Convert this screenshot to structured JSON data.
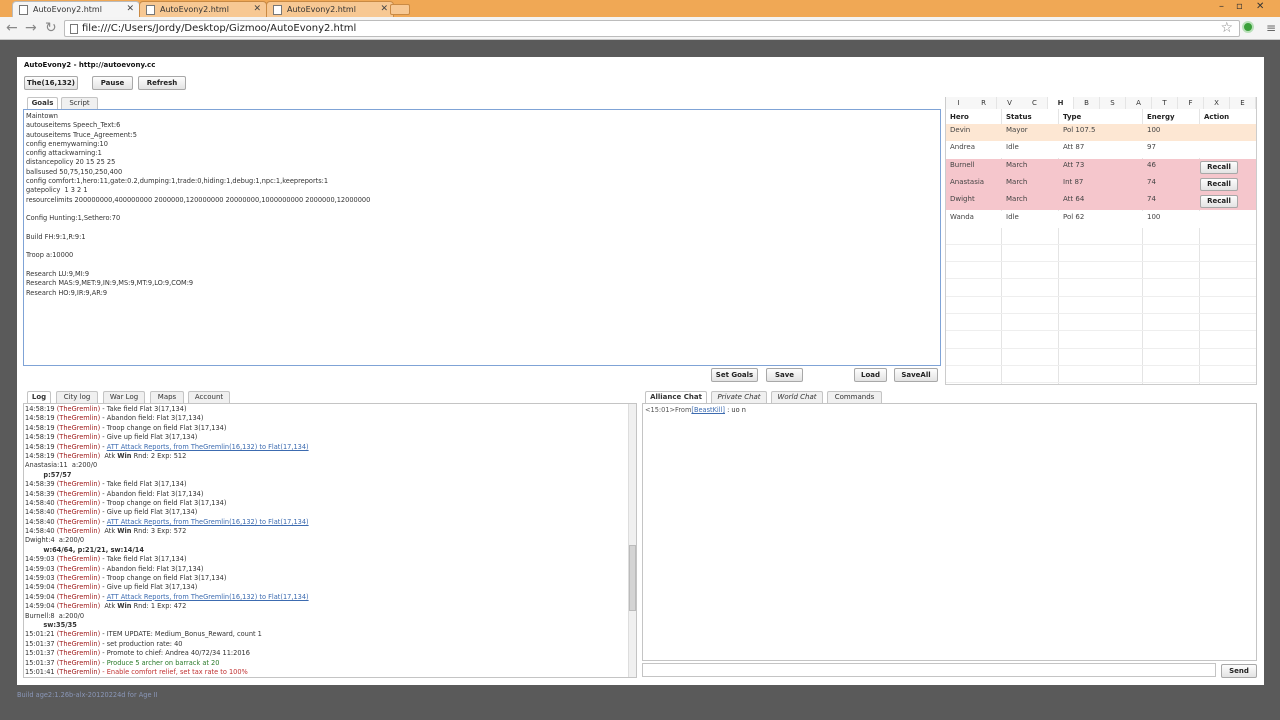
{
  "browser": {
    "tabs": [
      {
        "title": "AutoEvony2.html"
      },
      {
        "title": "AutoEvony2.html"
      },
      {
        "title": "AutoEvony2.html"
      }
    ],
    "url": "file:///C:/Users/Jordy/Desktop/Gizmoo/AutoEvony2.html"
  },
  "app": {
    "title": "AutoEvony2 - http://autoevony.cc",
    "toolbar": {
      "city": "The(16,132)",
      "pause": "Pause",
      "refresh": "Refresh"
    },
    "goal_tabs": [
      "Goals",
      "Script"
    ],
    "goals_text": "Maintown\nautouseitems Speech_Text:6\nautouseitems Truce_Agreement:5\nconfig enemywarning:10\nconfig attackwarning:1\ndistancepolicy 20 15 25 25\nballsused 50,75,150,250,400\nconfig comfort:1,hero:11,gate:0.2,dumping:1,trade:0,hiding:1,debug:1,npc:1,keepreports:1\ngatepolicy  1 3 2 1\nresourcelimits 200000000,400000000 2000000,120000000 20000000,1000000000 2000000,12000000\n\nConfig Hunting:1,Sethero:70\n\nBuild FH:9:1,R:9:1\n\nTroop a:10000\n\nResearch LU:9,MI:9\nResearch MAS:9,MET:9,IN:9,MS:9,MT:9,LO:9,COM:9\nResearch HO:9,IR:9,AR:9",
    "goal_buttons": {
      "set_goals": "Set Goals",
      "save": "Save",
      "load": "Load",
      "save_all": "SaveAll"
    },
    "hero_letters": [
      "I",
      "R",
      "V",
      "C",
      "H",
      "B",
      "S",
      "A",
      "T",
      "F",
      "X",
      "E"
    ],
    "hero_columns": [
      "Hero",
      "Status",
      "Type",
      "Energy",
      "Action"
    ],
    "heroes": [
      {
        "name": "Devin",
        "status": "Mayor",
        "type": "Pol 107.5",
        "energy": "100",
        "action": ""
      },
      {
        "name": "Andrea",
        "status": "Idle",
        "type": "Att 87",
        "energy": "97",
        "action": ""
      },
      {
        "name": "Burnell",
        "status": "March",
        "type": "Att 73",
        "energy": "46",
        "action": "Recall"
      },
      {
        "name": "Anastasia",
        "status": "March",
        "type": "Int 87",
        "energy": "74",
        "action": "Recall"
      },
      {
        "name": "Dwight",
        "status": "March",
        "type": "Att 64",
        "energy": "74",
        "action": "Recall"
      },
      {
        "name": "Wanda",
        "status": "Idle",
        "type": "Pol 62",
        "energy": "100",
        "action": ""
      }
    ],
    "log_tabs": [
      "Log",
      "City log",
      "War Log",
      "Maps",
      "Account"
    ],
    "log": [
      {
        "t": "14:58:19",
        "w": "(TheGremlin)",
        "m": " - Take field Flat 3(17,134)",
        "c": ""
      },
      {
        "t": "14:58:19",
        "w": "(TheGremlin)",
        "m": " - Abandon field: Flat 3(17,134)",
        "c": ""
      },
      {
        "t": "14:58:19",
        "w": "(TheGremlin)",
        "m": " - Troop change on field Flat 3(17,134)",
        "c": ""
      },
      {
        "t": "14:58:19",
        "w": "(TheGremlin)",
        "m": " - Give up field Flat 3(17,134)",
        "c": ""
      },
      {
        "t": "14:58:19",
        "w": "(TheGremlin)",
        "m": "ATT Attack Reports, from TheGremlin(16,132) to Flat(17,134)",
        "c": "lnk"
      },
      {
        "t": "14:58:19",
        "w": "(TheGremlin)",
        "m": "  Atk Win Rnd: 2 Exp: 512",
        "c": "atk"
      },
      {
        "raw": "Anastasia:11  a:200/0"
      },
      {
        "raw": "        p:57/57",
        "bold": true
      },
      {
        "t": "14:58:39",
        "w": "(TheGremlin)",
        "m": " - Take field Flat 3(17,134)",
        "c": ""
      },
      {
        "t": "14:58:39",
        "w": "(TheGremlin)",
        "m": " - Abandon field: Flat 3(17,134)",
        "c": ""
      },
      {
        "t": "14:58:40",
        "w": "(TheGremlin)",
        "m": " - Troop change on field Flat 3(17,134)",
        "c": ""
      },
      {
        "t": "14:58:40",
        "w": "(TheGremlin)",
        "m": " - Give up field Flat 3(17,134)",
        "c": ""
      },
      {
        "t": "14:58:40",
        "w": "(TheGremlin)",
        "m": "ATT Attack Reports, from TheGremlin(16,132) to Flat(17,134)",
        "c": "lnk"
      },
      {
        "t": "14:58:40",
        "w": "(TheGremlin)",
        "m": "  Atk Win Rnd: 3 Exp: 572",
        "c": "atk"
      },
      {
        "raw": "Dwight:4  a:200/0"
      },
      {
        "raw": "        w:64/64, p:21/21, sw:14/14",
        "bold": true
      },
      {
        "t": "14:59:03",
        "w": "(TheGremlin)",
        "m": " - Take field Flat 3(17,134)",
        "c": ""
      },
      {
        "t": "14:59:03",
        "w": "(TheGremlin)",
        "m": " - Abandon field: Flat 3(17,134)",
        "c": ""
      },
      {
        "t": "14:59:03",
        "w": "(TheGremlin)",
        "m": " - Troop change on field Flat 3(17,134)",
        "c": ""
      },
      {
        "t": "14:59:04",
        "w": "(TheGremlin)",
        "m": " - Give up field Flat 3(17,134)",
        "c": ""
      },
      {
        "t": "14:59:04",
        "w": "(TheGremlin)",
        "m": "ATT Attack Reports, from TheGremlin(16,132) to Flat(17,134)",
        "c": "lnk"
      },
      {
        "t": "14:59:04",
        "w": "(TheGremlin)",
        "m": "  Atk Win Rnd: 1 Exp: 472",
        "c": "atk"
      },
      {
        "raw": "Burnell:8  a:200/0"
      },
      {
        "raw": "        sw:35/35",
        "bold": true
      },
      {
        "t": "15:01:21",
        "w": "(TheGremlin)",
        "m": " - ITEM UPDATE: Medium_Bonus_Reward, count 1",
        "c": ""
      },
      {
        "t": "15:01:37",
        "w": "(TheGremlin)",
        "m": " - set production rate: 40",
        "c": ""
      },
      {
        "t": "15:01:37",
        "w": "(TheGremlin)",
        "m": " - Promote to chief: Andrea 40/72/34 11:2016",
        "c": ""
      },
      {
        "t": "15:01:37",
        "w": "(TheGremlin)",
        "m": " - Produce 5 archer on barrack at 20",
        "c": "grn"
      },
      {
        "t": "15:01:41",
        "w": "(TheGremlin)",
        "m": " - Enable comfort relief, set tax rate to 100%",
        "c": "red"
      }
    ],
    "chat_tabs": [
      "Alliance Chat",
      "Private Chat",
      "World Chat",
      "Commands"
    ],
    "chat": {
      "time": "<15:01>From",
      "user": "[BeastKill]",
      "msg": " : uo n"
    },
    "send": "Send",
    "status": "Build age2:1.26b-alx-20120224d for Age II"
  },
  "colors": {
    "accent": "#7fa3d6",
    "march_row": "#f5c6cc",
    "mayor_row": "#fde7d3",
    "tabbar": "#f0a855"
  }
}
